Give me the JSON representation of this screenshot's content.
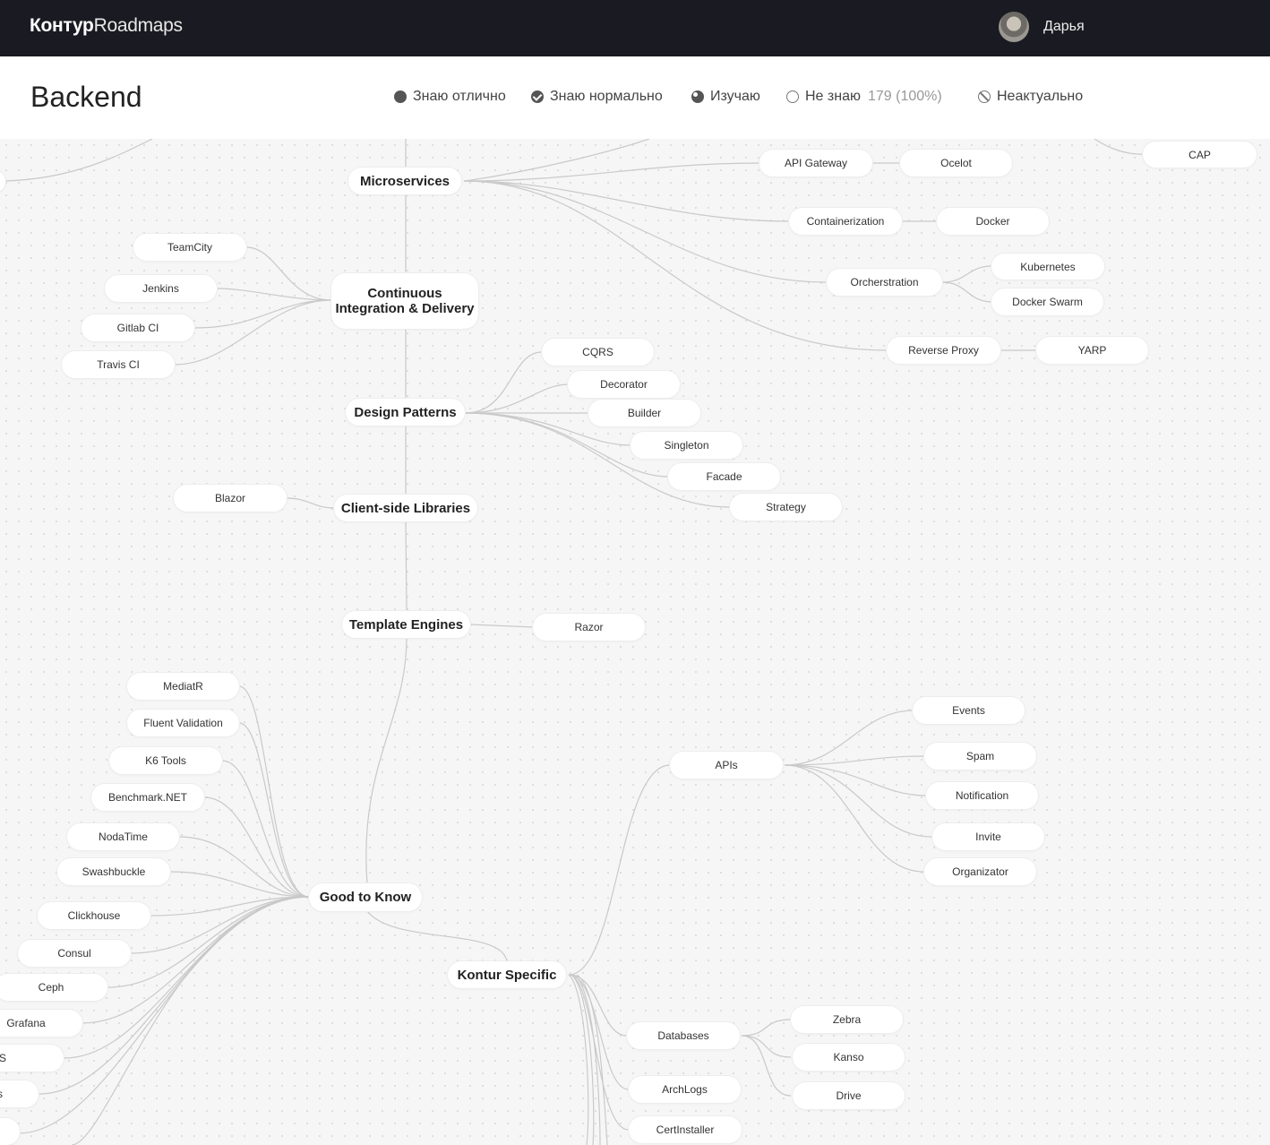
{
  "topbar": {
    "logo_bold": "Контур",
    "logo_light": "Roadmaps",
    "user_name": "Дарья"
  },
  "header": {
    "title": "Backend",
    "legend": {
      "excellent": "Знаю отлично",
      "normal": "Знаю нормально",
      "learning": "Изучаю",
      "unknown": "Не знаю",
      "unknown_count": "179 (100%)",
      "irrelevant": "Неактуально"
    }
  },
  "roadmap": {
    "main": {
      "microservices": "Microservices",
      "ci": "Continuous Integration & Delivery",
      "design_patterns": "Design Patterns",
      "client_libs": "Client-side Libraries",
      "template_engines": "Template Engines",
      "good_to_know": "Good to Know",
      "kontur_specific": "Kontur Specific"
    },
    "nodes": {
      "cap": "CAP",
      "api_gateway": "API Gateway",
      "ocelot": "Ocelot",
      "containerization": "Containerization",
      "docker": "Docker",
      "orchestration": "Orcherstration",
      "kubernetes": "Kubernetes",
      "docker_swarm": "Docker Swarm",
      "reverse_proxy": "Reverse Proxy",
      "yarp": "YARP",
      "teamcity": "TeamCity",
      "jenkins": "Jenkins",
      "gitlab_ci": "Gitlab CI",
      "travis_ci": "Travis CI",
      "cqrs": "CQRS",
      "decorator": "Decorator",
      "builder": "Builder",
      "singleton": "Singleton",
      "facade": "Facade",
      "strategy": "Strategy",
      "blazor": "Blazor",
      "razor": "Razor",
      "mediatr": "MediatR",
      "fluent_validation": "Fluent Validation",
      "k6_tools": "K6 Tools",
      "benchmark_net": "Benchmark.NET",
      "nodatime": "NodaTime",
      "swashbuckle": "Swashbuckle",
      "clickhouse": "Clickhouse",
      "consul": "Consul",
      "ceph": "Ceph",
      "grafana": "Grafana",
      "iis": "IIS",
      "partial_1": "s",
      "apis": "APIs",
      "events": "Events",
      "spam": "Spam",
      "notification": "Notification",
      "invite": "Invite",
      "organizator": "Organizator",
      "databases": "Databases",
      "zebra": "Zebra",
      "kanso": "Kanso",
      "drive": "Drive",
      "archlogs": "ArchLogs",
      "certinstaller": "CertInstaller"
    }
  }
}
